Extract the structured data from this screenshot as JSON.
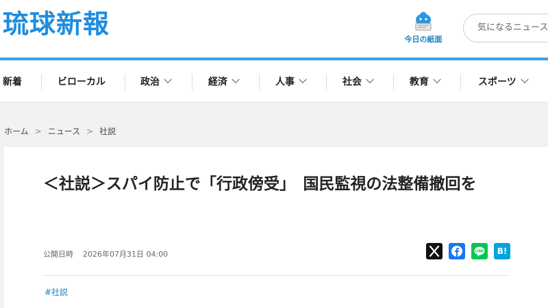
{
  "header": {
    "logo_text": "琉球新報",
    "paper_label": "今日の紙面",
    "search_placeholder": "気になるニュースを検索"
  },
  "nav": {
    "items": [
      {
        "label": "新着"
      },
      {
        "label": "ビローカル"
      },
      {
        "label": "政治"
      },
      {
        "label": "経済"
      },
      {
        "label": "人事"
      },
      {
        "label": "社会"
      },
      {
        "label": "教育"
      },
      {
        "label": "スポーツ"
      }
    ]
  },
  "breadcrumb": {
    "items": [
      "ホーム",
      "ニュース",
      "社説"
    ]
  },
  "article": {
    "title": "＜社説＞スパイ防止で「行政傍受」　国民監視の法整備撤回を",
    "published_label": "公開日時",
    "published_date": "2026年07月31日 04:00",
    "tag": "#社説"
  },
  "share": {
    "x_label": "X",
    "facebook_label": "f",
    "line_label": "LINE",
    "hatena_label": "B!"
  },
  "colors": {
    "brand": "#1d8de0",
    "accent_line": "#3aa6e8",
    "tag": "#1d7fc0"
  }
}
